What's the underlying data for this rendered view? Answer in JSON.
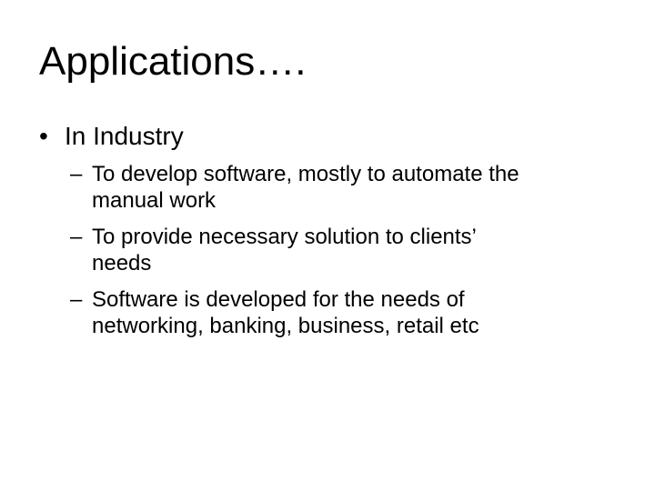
{
  "slide": {
    "title": "Applications….",
    "bullets": [
      {
        "marker": "•",
        "text": "In Industry",
        "sub_marker": "–",
        "sub_items": [
          {
            "lines": [
              "To develop software, mostly to automate the",
              "manual work"
            ]
          },
          {
            "lines": [
              "To provide necessary solution to clients’",
              "needs"
            ]
          },
          {
            "lines": [
              "Software is developed for the needs of",
              "networking, banking, business, retail etc"
            ]
          }
        ]
      }
    ]
  }
}
